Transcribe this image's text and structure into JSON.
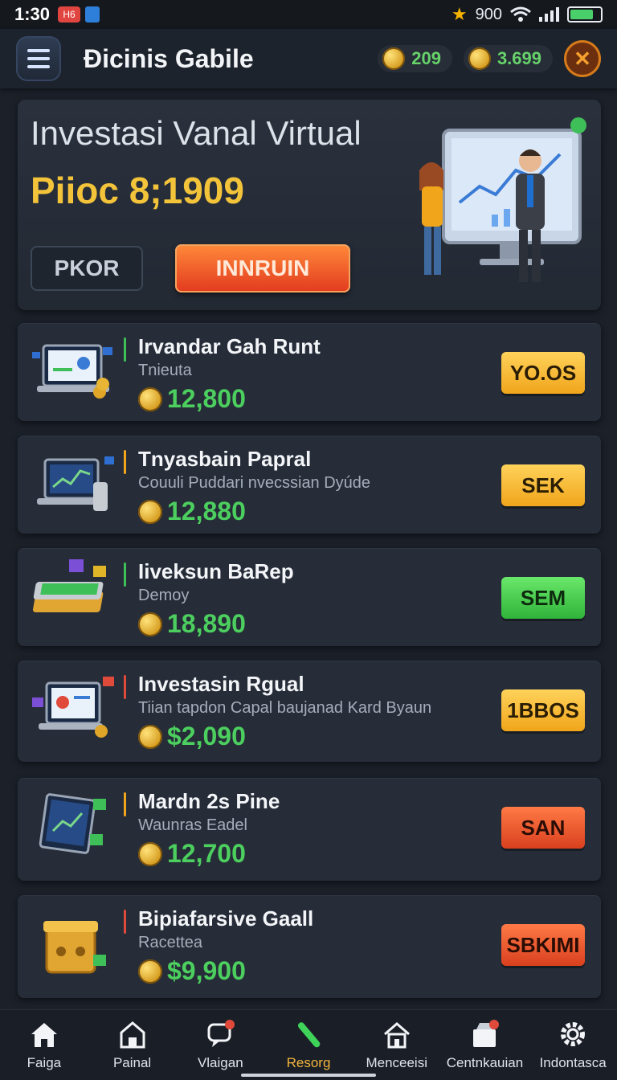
{
  "status_bar": {
    "time": "1:30",
    "notification_badge": "H6",
    "signal_text": "900"
  },
  "header": {
    "title": "Đicinis Gabile",
    "coin_balance_1": "209",
    "coin_balance_2": "3.699"
  },
  "hero": {
    "title": "Investasi Vanal Virtual",
    "price": "Piioc 8;1909",
    "secondary_button": "PKOR",
    "primary_button": "INNRUIN"
  },
  "cards": [
    {
      "title": "Irvandar Gah Runt",
      "subtitle": "Tnieuta",
      "amount": "12,800",
      "button": "YO.OS",
      "accent": "#3fbf58",
      "btn_style": "yellow"
    },
    {
      "title": "Tnyasbain Papral",
      "subtitle": "Couuli Puddari nvecssian Dyúde",
      "amount": "12,880",
      "button": "SEK",
      "accent": "#f0a51b",
      "btn_style": "yellow"
    },
    {
      "title": "Iiveksun BaRep",
      "subtitle": "Demoy",
      "amount": "18,890",
      "button": "SEM",
      "accent": "#3fbf58",
      "btn_style": "green"
    },
    {
      "title": "Investasin Rgual",
      "subtitle": "Tiian tapdon Capal baujanad Kard Byaun",
      "amount": "$2,090",
      "button": "1BBOS",
      "accent": "#e04a3b",
      "btn_style": "yellow"
    },
    {
      "title": "Mardn 2s Pine",
      "subtitle": "Waunras Eadel",
      "amount": "12,700",
      "button": "SAN",
      "accent": "#f0a51b",
      "btn_style": "red"
    },
    {
      "title": "Bipiafarsive Gaall",
      "subtitle": "Racettea",
      "amount": "$9,900",
      "button": "SBKIMI",
      "accent": "#e04a3b",
      "btn_style": "red"
    }
  ],
  "nav": [
    {
      "label": "Faiga",
      "icon": "home-icon"
    },
    {
      "label": "Painal",
      "icon": "building-icon"
    },
    {
      "label": "Vlaigan",
      "icon": "chat-icon"
    },
    {
      "label": "Resorg",
      "icon": "pen-icon"
    },
    {
      "label": "Menceeisi",
      "icon": "house-outline-icon"
    },
    {
      "label": "Centnkauian",
      "icon": "store-icon"
    },
    {
      "label": "Indontasca",
      "icon": "gear-icon"
    }
  ]
}
